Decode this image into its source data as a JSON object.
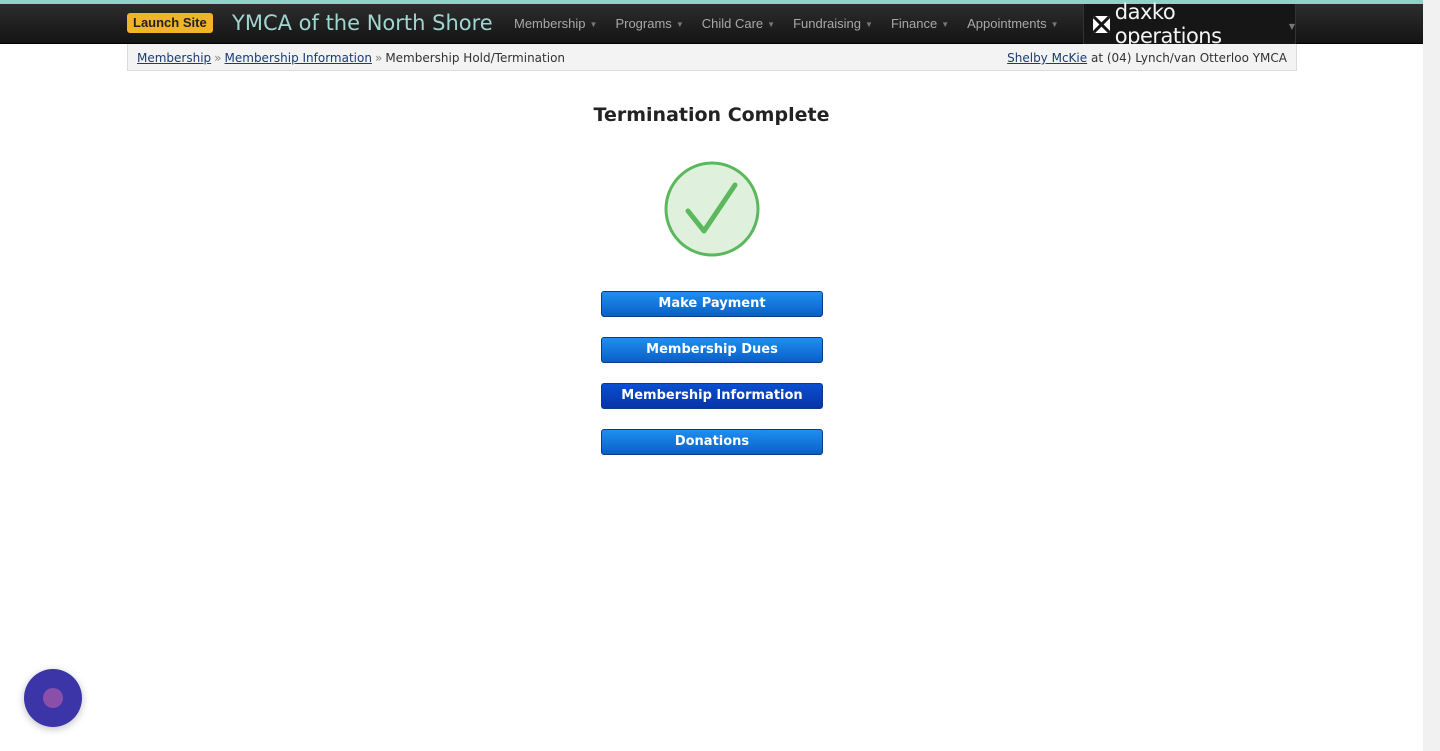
{
  "header": {
    "launch_label": "Launch Site",
    "org_title": "YMCA of the North Shore",
    "menu": [
      {
        "label": "Membership"
      },
      {
        "label": "Programs"
      },
      {
        "label": "Child Care"
      },
      {
        "label": "Fundraising"
      },
      {
        "label": "Finance"
      },
      {
        "label": "Appointments"
      }
    ],
    "brand": {
      "icon": "daxko-envelope-icon",
      "text": "daxko operations"
    }
  },
  "breadcrumb": {
    "items": [
      "Membership",
      "Membership Information"
    ],
    "current": "Membership Hold/Termination",
    "separator": "»"
  },
  "user": {
    "name": "Shelby McKie",
    "at_label": "at",
    "location": "(04) Lynch/van Otterloo YMCA"
  },
  "main": {
    "title": "Termination Complete",
    "status_icon": "checkmark-circle-icon",
    "status_color": "#5cb85c",
    "buttons": [
      {
        "label": "Make Payment"
      },
      {
        "label": "Membership Dues"
      },
      {
        "label": "Membership Information"
      },
      {
        "label": "Donations"
      }
    ]
  },
  "colors": {
    "accent_bar": "#8fd3c8",
    "launch_button": "#f0b429",
    "button_blue": "#0a6fd8",
    "chat_launcher": "#3b35a8"
  }
}
